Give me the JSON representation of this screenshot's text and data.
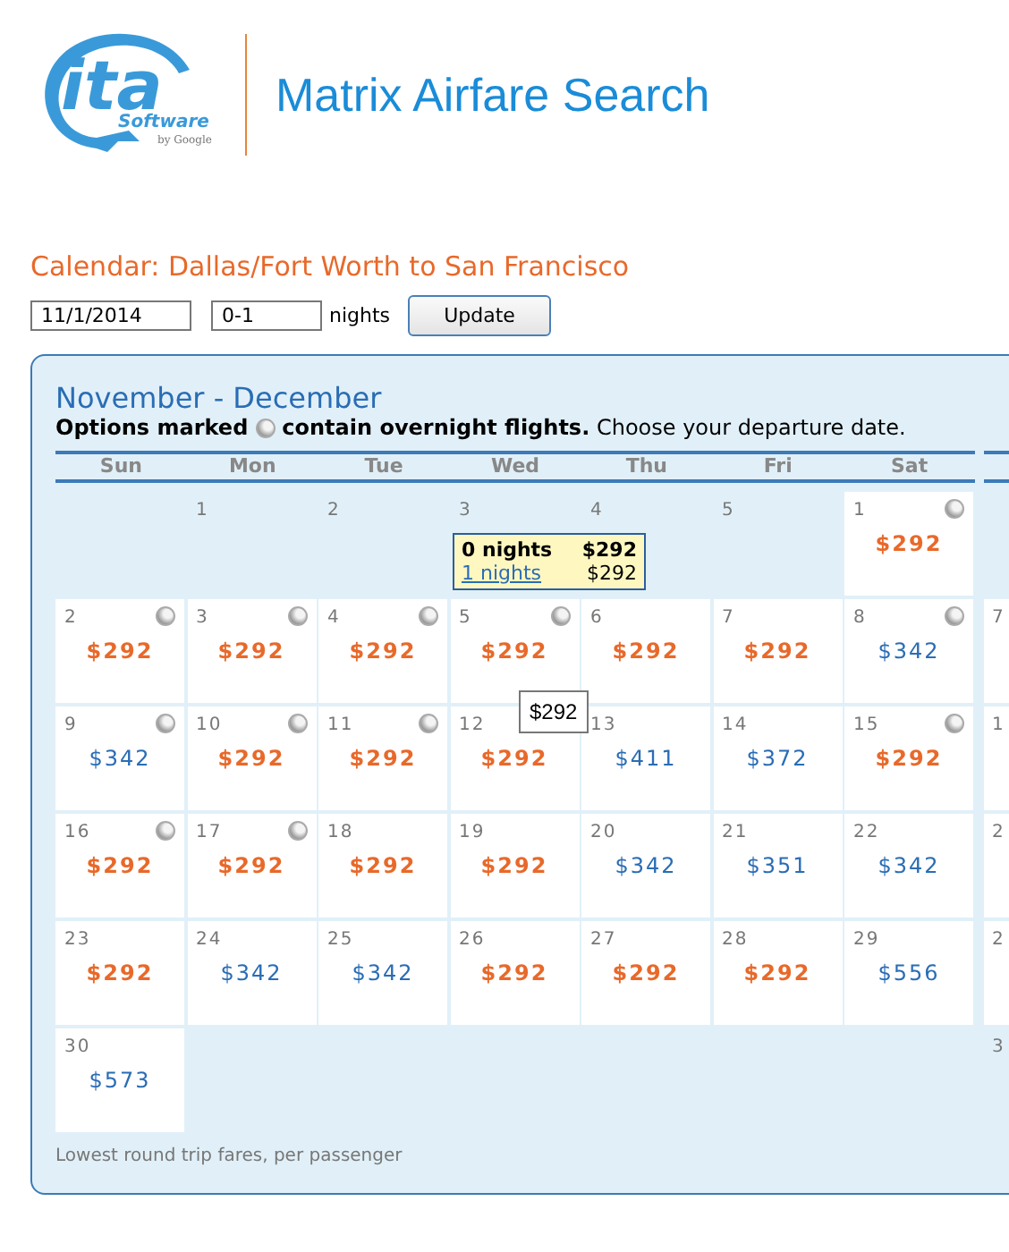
{
  "logo": {
    "wordmark": "ita",
    "subtitle": "Software",
    "byline": "by Google"
  },
  "title": "Matrix Airfare Search",
  "calendar_heading": "Calendar: Dallas/Fort Worth to San Francisco",
  "form": {
    "date": "11/1/2014",
    "nights": "0-1",
    "nights_label": "nights",
    "button": "Update"
  },
  "calendar": {
    "months": "November - December",
    "legend": {
      "bold_before": "Options marked",
      "bold_after": "contain overnight flights.",
      "rest": "Choose your departure date."
    },
    "weekdays": [
      "Sun",
      "Mon",
      "Tue",
      "Wed",
      "Thu",
      "Fri",
      "Sat"
    ],
    "weeks": [
      [
        {
          "day": "1",
          "open": false
        },
        {
          "day": "2",
          "open": false
        },
        {
          "day": "3",
          "open": false
        },
        {
          "day": "4",
          "open": false
        },
        {
          "day": "5",
          "open": false
        },
        {
          "day": "1",
          "open": true,
          "price": "$292",
          "lowest": true,
          "overnight": true
        }
      ],
      [
        {
          "day": "2",
          "open": true,
          "price": "$292",
          "lowest": true,
          "overnight": true
        },
        {
          "day": "3",
          "open": true,
          "price": "$292",
          "lowest": true,
          "overnight": true
        },
        {
          "day": "4",
          "open": true,
          "price": "$292",
          "lowest": true,
          "overnight": true
        },
        {
          "day": "5",
          "open": true,
          "price": "$292",
          "lowest": true,
          "overnight": true
        },
        {
          "day": "6",
          "open": true,
          "price": "$292",
          "lowest": true,
          "overnight": false
        },
        {
          "day": "7",
          "open": true,
          "price": "$292",
          "lowest": true,
          "overnight": false
        },
        {
          "day": "8",
          "open": true,
          "price": "$342",
          "lowest": false,
          "overnight": true
        }
      ],
      [
        {
          "day": "9",
          "open": true,
          "price": "$342",
          "lowest": false,
          "overnight": true
        },
        {
          "day": "10",
          "open": true,
          "price": "$292",
          "lowest": true,
          "overnight": true
        },
        {
          "day": "11",
          "open": true,
          "price": "$292",
          "lowest": true,
          "overnight": true
        },
        {
          "day": "12",
          "open": true,
          "price": "$292",
          "lowest": true,
          "overnight": false
        },
        {
          "day": "13",
          "open": true,
          "price": "$411",
          "lowest": false,
          "overnight": false
        },
        {
          "day": "14",
          "open": true,
          "price": "$372",
          "lowest": false,
          "overnight": false
        },
        {
          "day": "15",
          "open": true,
          "price": "$292",
          "lowest": true,
          "overnight": true
        }
      ],
      [
        {
          "day": "16",
          "open": true,
          "price": "$292",
          "lowest": true,
          "overnight": true
        },
        {
          "day": "17",
          "open": true,
          "price": "$292",
          "lowest": true,
          "overnight": true
        },
        {
          "day": "18",
          "open": true,
          "price": "$292",
          "lowest": true,
          "overnight": false
        },
        {
          "day": "19",
          "open": true,
          "price": "$292",
          "lowest": true,
          "overnight": false
        },
        {
          "day": "20",
          "open": true,
          "price": "$342",
          "lowest": false,
          "overnight": false
        },
        {
          "day": "21",
          "open": true,
          "price": "$351",
          "lowest": false,
          "overnight": false
        },
        {
          "day": "22",
          "open": true,
          "price": "$342",
          "lowest": false,
          "overnight": false
        }
      ],
      [
        {
          "day": "23",
          "open": true,
          "price": "$292",
          "lowest": true,
          "overnight": false
        },
        {
          "day": "24",
          "open": true,
          "price": "$342",
          "lowest": false,
          "overnight": false
        },
        {
          "day": "25",
          "open": true,
          "price": "$342",
          "lowest": false,
          "overnight": false
        },
        {
          "day": "26",
          "open": true,
          "price": "$292",
          "lowest": true,
          "overnight": false
        },
        {
          "day": "27",
          "open": true,
          "price": "$292",
          "lowest": true,
          "overnight": false
        },
        {
          "day": "28",
          "open": true,
          "price": "$292",
          "lowest": true,
          "overnight": false
        },
        {
          "day": "29",
          "open": true,
          "price": "$556",
          "lowest": false,
          "overnight": false
        }
      ],
      [
        {
          "day": "30",
          "open": true,
          "price": "$573",
          "lowest": false,
          "overnight": false
        }
      ]
    ],
    "next_month_column": [
      {
        "day": "7",
        "open": true
      },
      {
        "day": "1",
        "open": true
      },
      {
        "day": "2",
        "open": true
      },
      {
        "day": "2",
        "open": true
      },
      {
        "day": "3",
        "open": false
      }
    ],
    "popup": {
      "rows": [
        {
          "nights": "0 nights",
          "price": "$292",
          "selected": true
        },
        {
          "nights": "1 nights",
          "price": "$292",
          "selected": false
        }
      ]
    },
    "hover_tooltip": "$292",
    "footnote": "Lowest round trip fares, per passenger"
  }
}
